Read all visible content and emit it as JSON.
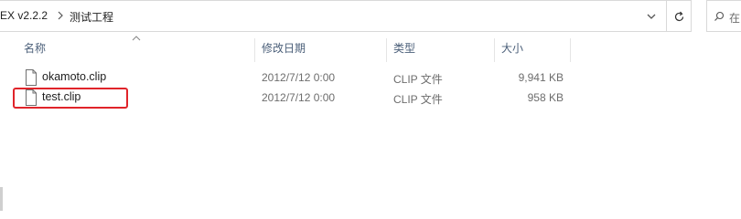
{
  "address_bar": {
    "crumbs": [
      "EX v2.2.2",
      "测试工程"
    ],
    "separator_icon": "chevron-right-icon",
    "dropdown_icon": "chevron-down-icon",
    "refresh_icon": "refresh-icon"
  },
  "search": {
    "placeholder": "在 测",
    "icon": "search-icon"
  },
  "columns": {
    "name": "名称",
    "date": "修改日期",
    "type": "类型",
    "size": "大小"
  },
  "files": [
    {
      "name": "okamoto.clip",
      "date": "2012/7/12 0:00",
      "type": "CLIP 文件",
      "size": "9,941 KB",
      "icon": "file-icon"
    },
    {
      "name": "test.clip",
      "date": "2012/7/12 0:00",
      "type": "CLIP 文件",
      "size": "958 KB",
      "icon": "file-icon"
    }
  ],
  "highlight_color": "#e0242a",
  "header_text_color": "#4c607a"
}
